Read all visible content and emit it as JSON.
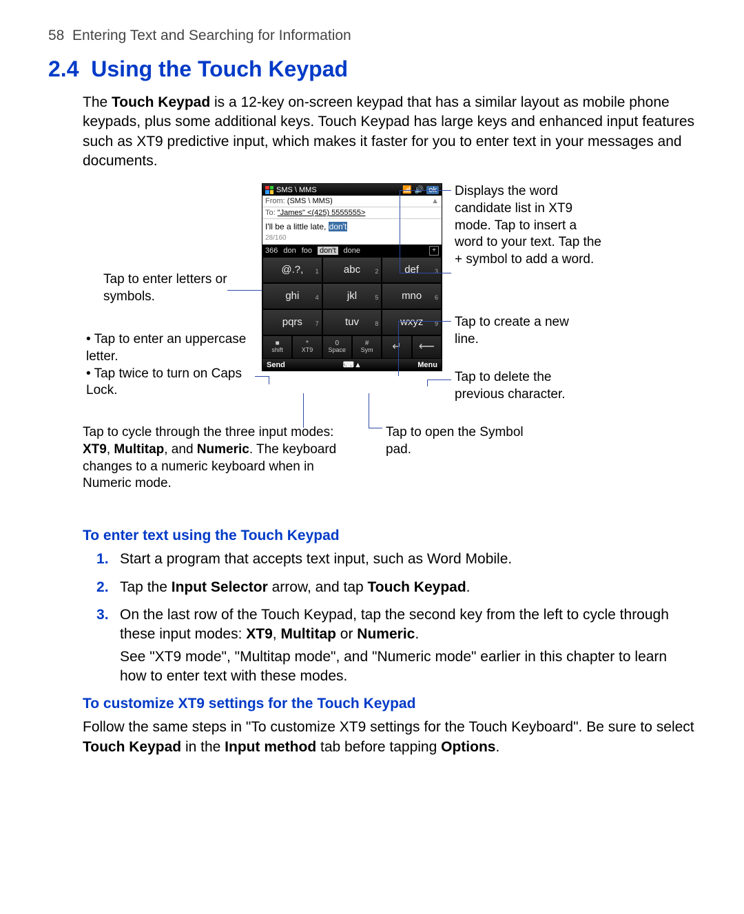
{
  "header": {
    "page_number": "58",
    "chapter_title": "Entering Text and Searching for Information"
  },
  "section": {
    "number": "2.4",
    "title": "Using the Touch Keypad"
  },
  "intro": {
    "pre": "The ",
    "bold1": "Touch Keypad",
    "rest": " is a 12-key on-screen keypad that has a similar layout as mobile phone keypads, plus some additional keys. Touch Keypad has large keys and enhanced input features such as XT9 predictive input, which makes it faster for you to enter text in your messages and documents."
  },
  "device": {
    "title": "SMS \\ MMS",
    "ok": "ok",
    "from_label": "From:",
    "from_value": "(SMS \\ MMS)",
    "to_label": "To:",
    "to_value": "\"James\" <(425) 5555555>",
    "message_pre": "I'll be a little late, ",
    "message_hl": "don't",
    "counter": "28/160",
    "candidates": [
      "366",
      "don",
      "foo",
      "don't",
      "done"
    ],
    "plus": "+",
    "keys": [
      {
        "num": "1",
        "label": "@.?,"
      },
      {
        "num": "2",
        "label": "abc"
      },
      {
        "num": "3",
        "label": "def"
      },
      {
        "num": "4",
        "label": "ghi"
      },
      {
        "num": "5",
        "label": "jkl"
      },
      {
        "num": "6",
        "label": "mno"
      },
      {
        "num": "7",
        "label": "pqrs"
      },
      {
        "num": "8",
        "label": "tuv"
      },
      {
        "num": "9",
        "label": "wxyz"
      }
    ],
    "bottom": {
      "shift_top": "■",
      "shift": "shift",
      "xt9_top": "*",
      "xt9": "XT9",
      "space_top": "0",
      "space": "Space",
      "sym_top": "#",
      "sym": "Sym",
      "enter": "↵",
      "back": "⟵"
    },
    "soft_left": "Send",
    "soft_mid": "⌨ ▴",
    "soft_right": "Menu"
  },
  "callouts": {
    "left1": "Tap to enter letters or symbols.",
    "left2a": "Tap to enter an uppercase letter.",
    "left2b": "Tap twice to turn on Caps Lock.",
    "right1": "Displays the word candidate list in XT9 mode. Tap to insert a word to your text. Tap the + symbol to add a word.",
    "right2": "Tap to create a new line.",
    "right3": "Tap to delete the previous character.",
    "bottom_right": "Tap to open the Symbol pad.",
    "bottom_left_pre": "Tap to cycle through the three input modes: ",
    "bottom_left_b1": "XT9",
    "bottom_left_mid1": ", ",
    "bottom_left_b2": "Multitap",
    "bottom_left_mid2": ", and ",
    "bottom_left_b3": "Numeric",
    "bottom_left_post": ". The keyboard changes to a numeric keyboard when in Numeric mode."
  },
  "h2a": "To enter text using the Touch Keypad",
  "steps": {
    "s1": "Start a program that accepts text input, such as Word Mobile.",
    "s2_pre": "Tap the ",
    "s2_b1": "Input Selector",
    "s2_mid": " arrow, and tap ",
    "s2_b2": "Touch Keypad",
    "s2_post": ".",
    "s3_pre": "On the last row of the Touch Keypad, tap the second key from the left to cycle through these input modes: ",
    "s3_b1": "XT9",
    "s3_mid1": ", ",
    "s3_b2": "Multitap",
    "s3_mid2": " or ",
    "s3_b3": "Numeric",
    "s3_post": ".",
    "s3_follow": "See \"XT9 mode\", \"Multitap mode\", and \"Numeric mode\" earlier in this chapter to learn how to enter text with these modes."
  },
  "h2b": "To customize XT9 settings for the Touch Keypad",
  "para2": {
    "pre": "Follow the same steps in \"To customize XT9 settings for the Touch Keyboard\". Be sure to select ",
    "b1": "Touch Keypad",
    "mid": " in the ",
    "b2": "Input method",
    "post": " tab before tapping ",
    "b3": "Options",
    "end": "."
  }
}
